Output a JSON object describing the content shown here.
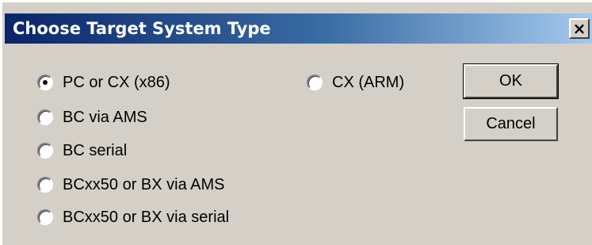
{
  "dialog": {
    "title": "Choose Target System Type",
    "close_label": "×"
  },
  "options": [
    {
      "label": "PC or CX (x86)",
      "checked": true
    },
    {
      "label": "BC via AMS",
      "checked": false
    },
    {
      "label": "BC serial",
      "checked": false
    },
    {
      "label": "BCxx50 or BX via AMS",
      "checked": false
    },
    {
      "label": "BCxx50 or BX via serial",
      "checked": false
    },
    {
      "label": "CX (ARM)",
      "checked": false
    }
  ],
  "buttons": {
    "ok_label": "OK",
    "cancel_label": "Cancel"
  },
  "colors": {
    "face": "#d4d0c8",
    "title_start": "#0a246a",
    "title_end": "#a6caf0"
  }
}
